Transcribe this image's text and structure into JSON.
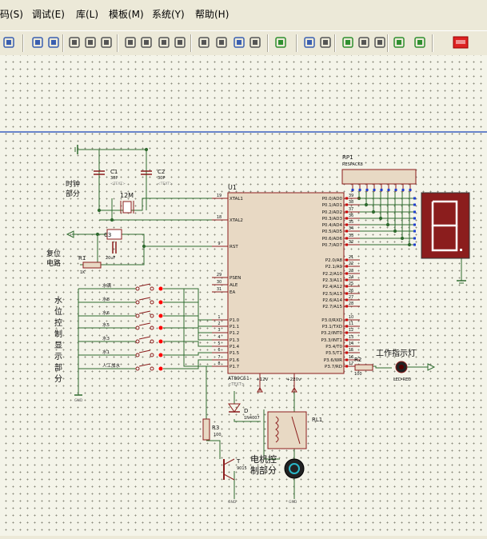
{
  "menu": {
    "items": [
      "码(S)",
      "调试(E)",
      "库(L)",
      "模板(M)",
      "系统(Y)",
      "帮助(H)"
    ]
  },
  "toolbar": {
    "icons": [
      "zoom-icon",
      "undo-icon",
      "redo-icon",
      "cut-icon",
      "copy-icon",
      "paste-icon",
      "block-copy-icon",
      "block-move-icon",
      "block-rotate-icon",
      "block-delete-icon",
      "pick-device-icon",
      "make-device-icon",
      "package-icon",
      "decompose-icon",
      "wire-autorouter-icon",
      "search-tag-icon",
      "property-tool-icon",
      "netlist-icon",
      "bill-of-materials-icon",
      "electrical-check-icon",
      "netlist-to-ares-icon",
      "ares-icon"
    ]
  },
  "schematic": {
    "colors": {
      "component": "#8b1d1d",
      "wire": "#2f6b2f",
      "body_fill": "#e8d9c4",
      "pin_blue": "#1f3fd0",
      "led_red": "#ff0000",
      "segment_bg": "#8b1d1d"
    },
    "mcu": {
      "ref": "U1",
      "part": "AT89C51",
      "text_tag": "<TEXT>",
      "left_pins": [
        {
          "num": "19",
          "name": "XTAL1"
        },
        {
          "num": "18",
          "name": "XTAL2"
        },
        {
          "num": "9",
          "name": "RST"
        },
        {
          "num": "29",
          "name": "PSEN"
        },
        {
          "num": "30",
          "name": "ALE"
        },
        {
          "num": "31",
          "name": "EA"
        },
        {
          "num": "1",
          "name": "P1.0"
        },
        {
          "num": "2",
          "name": "P1.1"
        },
        {
          "num": "3",
          "name": "P1.2"
        },
        {
          "num": "4",
          "name": "P1.3"
        },
        {
          "num": "5",
          "name": "P1.4"
        },
        {
          "num": "6",
          "name": "P1.5"
        },
        {
          "num": "7",
          "name": "P1.6"
        },
        {
          "num": "8",
          "name": "P1.7"
        }
      ],
      "right_pins_p0": [
        {
          "num": "39",
          "name": "P0.0/AD0"
        },
        {
          "num": "38",
          "name": "P0.1/AD1"
        },
        {
          "num": "37",
          "name": "P0.2/AD2"
        },
        {
          "num": "36",
          "name": "P0.3/AD3"
        },
        {
          "num": "35",
          "name": "P0.4/AD4"
        },
        {
          "num": "34",
          "name": "P0.5/AD5"
        },
        {
          "num": "33",
          "name": "P0.6/AD6"
        },
        {
          "num": "32",
          "name": "P0.7/AD7"
        }
      ],
      "right_pins_p2": [
        {
          "num": "21",
          "name": "P2.0/A8"
        },
        {
          "num": "22",
          "name": "P2.1/A9"
        },
        {
          "num": "23",
          "name": "P2.2/A10"
        },
        {
          "num": "24",
          "name": "P2.3/A11"
        },
        {
          "num": "25",
          "name": "P2.4/A12"
        },
        {
          "num": "26",
          "name": "P2.5/A13"
        },
        {
          "num": "27",
          "name": "P2.6/A14"
        },
        {
          "num": "28",
          "name": "P2.7/A15"
        }
      ],
      "right_pins_p3": [
        {
          "num": "10",
          "name": "P3.0/RXD"
        },
        {
          "num": "11",
          "name": "P3.1/TXD"
        },
        {
          "num": "12",
          "name": "P3.2/INT0"
        },
        {
          "num": "13",
          "name": "P3.3/INT1"
        },
        {
          "num": "14",
          "name": "P3.4/T0"
        },
        {
          "num": "15",
          "name": "P3.5/T1"
        },
        {
          "num": "16",
          "name": "P3.6/WR"
        },
        {
          "num": "17",
          "name": "P3.7/RD"
        }
      ],
      "vcc1": "+12V",
      "vcc2": "+220v"
    },
    "crystal": {
      "ref": "12M",
      "label": "时钟\n部分"
    },
    "caps": [
      {
        "ref": "C1",
        "value": "30P"
      },
      {
        "ref": "C2",
        "value": "30P"
      },
      {
        "ref": "C3",
        "value": "20uF"
      }
    ],
    "reset": {
      "label": "复位\n电路",
      "resistor": "R1",
      "resistor_value": "1K"
    },
    "rp1": {
      "ref": "RP1",
      "part": "RESPACK8"
    },
    "water": {
      "label": "水位控制显示部分",
      "switches": [
        "水满",
        "水8",
        "水6",
        "水5",
        "水3",
        "水1",
        "人工加水"
      ]
    },
    "led": {
      "ref": "R2",
      "value": "100",
      "part": "LED-RED",
      "label": "工作指示灯"
    },
    "motor": {
      "label": "电机控制部分",
      "diode": "D",
      "diode_part": "1N4007",
      "relay": "RL1",
      "r3": "R3",
      "r3_value": "100",
      "transistor": "T",
      "transistor_part": "9015",
      "gnd": "GND"
    }
  }
}
